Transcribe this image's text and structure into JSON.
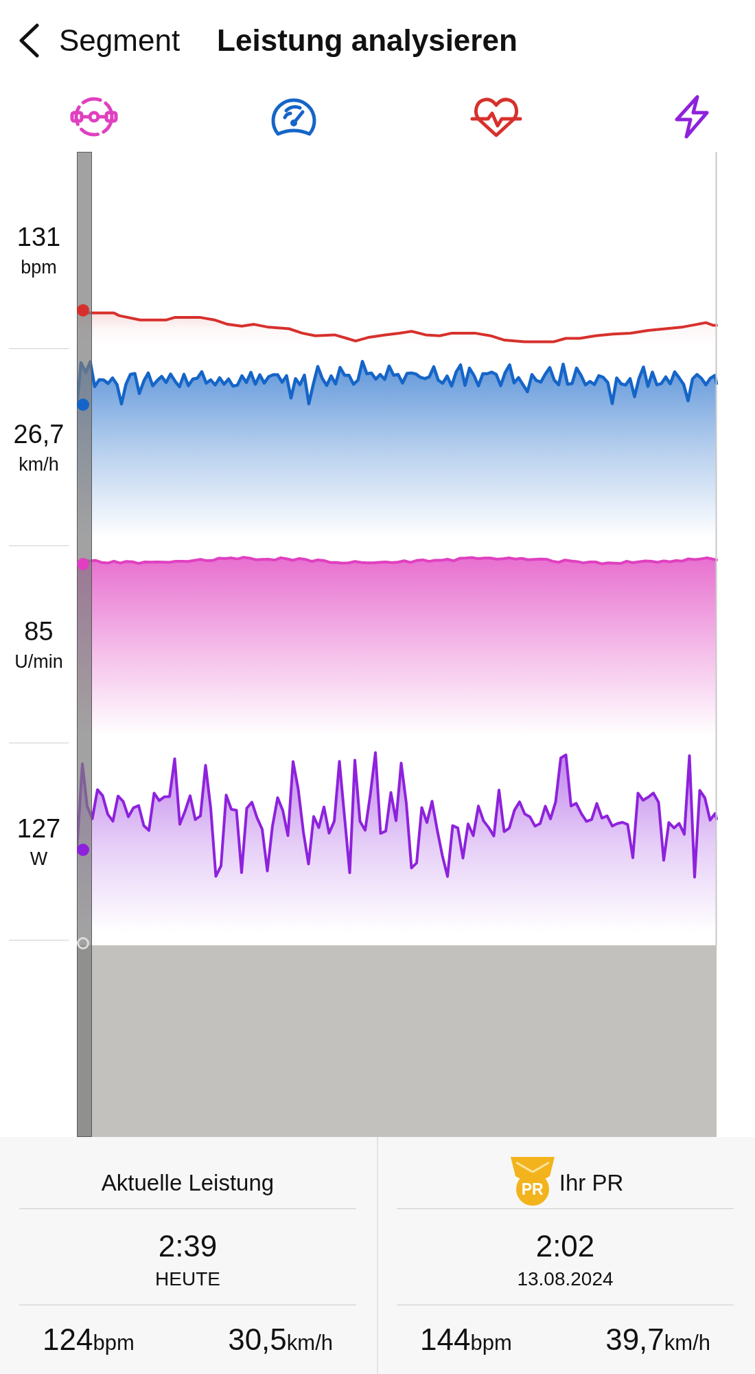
{
  "header": {
    "back_label": "Segment",
    "title": "Leistung analysieren"
  },
  "metrics": [
    {
      "kind": "cadence",
      "color": "#e040c0"
    },
    {
      "kind": "speed",
      "color": "#1565c8"
    },
    {
      "kind": "heart_rate",
      "color": "#d7302c"
    },
    {
      "kind": "power",
      "color": "#8e22dc"
    }
  ],
  "graph": {
    "readouts": [
      {
        "kind": "heart_rate",
        "value": "131",
        "unit": "bpm"
      },
      {
        "kind": "speed",
        "value": "26,7",
        "unit": "km/h"
      },
      {
        "kind": "cadence",
        "value": "85",
        "unit": "U/min"
      },
      {
        "kind": "power",
        "value": "127",
        "unit": "W"
      }
    ]
  },
  "comparison": [
    {
      "title": "Aktuelle Leistung",
      "time": "2:39",
      "date": "HEUTE",
      "stats": [
        {
          "value": "124",
          "unit": "bpm"
        },
        {
          "value": "30,5",
          "unit": "km/h"
        }
      ]
    },
    {
      "badge": "PR",
      "title": "Ihr PR",
      "time": "2:02",
      "date": "13.08.2024",
      "stats": [
        {
          "value": "144",
          "unit": "bpm"
        },
        {
          "value": "39,7",
          "unit": "km/h"
        }
      ]
    }
  ]
}
